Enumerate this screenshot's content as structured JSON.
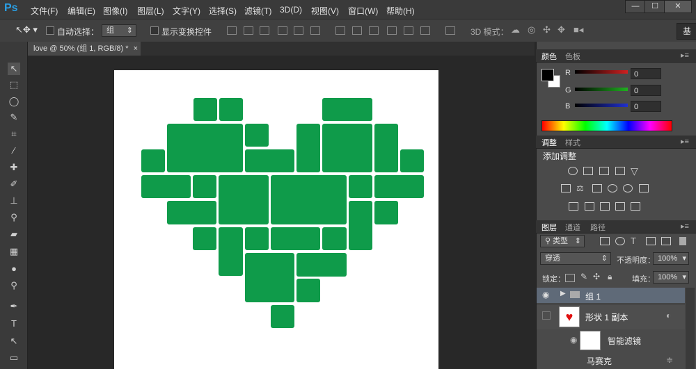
{
  "app": {
    "logo": "Ps"
  },
  "menu": [
    "文件(F)",
    "编辑(E)",
    "图像(I)",
    "图层(L)",
    "文字(Y)",
    "选择(S)",
    "滤镜(T)",
    "3D(D)",
    "视图(V)",
    "窗口(W)",
    "帮助(H)"
  ],
  "window_controls": [
    "—",
    "☐",
    "✕"
  ],
  "options": {
    "auto_select_label": "自动选择：",
    "auto_select_value": "组",
    "show_transform_label": "显示变换控件",
    "mode_3d_label": "3D 模式：",
    "workspace_label": "基"
  },
  "document": {
    "tab_title": "love @ 50% (组 1, RGB/8) *"
  },
  "color_panel": {
    "tabs": [
      "颜色",
      "色板"
    ],
    "channels": [
      {
        "label": "R",
        "value": "0",
        "color": "#d02020"
      },
      {
        "label": "G",
        "value": "0",
        "color": "#20b020"
      },
      {
        "label": "B",
        "value": "0",
        "color": "#2030d0"
      }
    ]
  },
  "adjust_panel": {
    "tabs": [
      "调整",
      "样式"
    ],
    "title": "添加调整"
  },
  "layers_panel": {
    "tabs": [
      "图层",
      "通道",
      "路径"
    ],
    "filter_label": "类型",
    "blend_mode": "穿透",
    "opacity_label": "不透明度：",
    "opacity_value": "100%",
    "lock_label": "锁定：",
    "fill_label": "填充：",
    "fill_value": "100%",
    "layers": [
      {
        "name": "组 1",
        "type": "group"
      },
      {
        "name": "形状 1 副本",
        "type": "smart"
      },
      {
        "name": "智能滤镜",
        "type": "filter"
      },
      {
        "name": "马赛克",
        "type": "filter-item"
      }
    ]
  },
  "colors": {
    "heart_green": "#0f9b4a",
    "foreground": "#000000",
    "background": "#ffffff"
  }
}
